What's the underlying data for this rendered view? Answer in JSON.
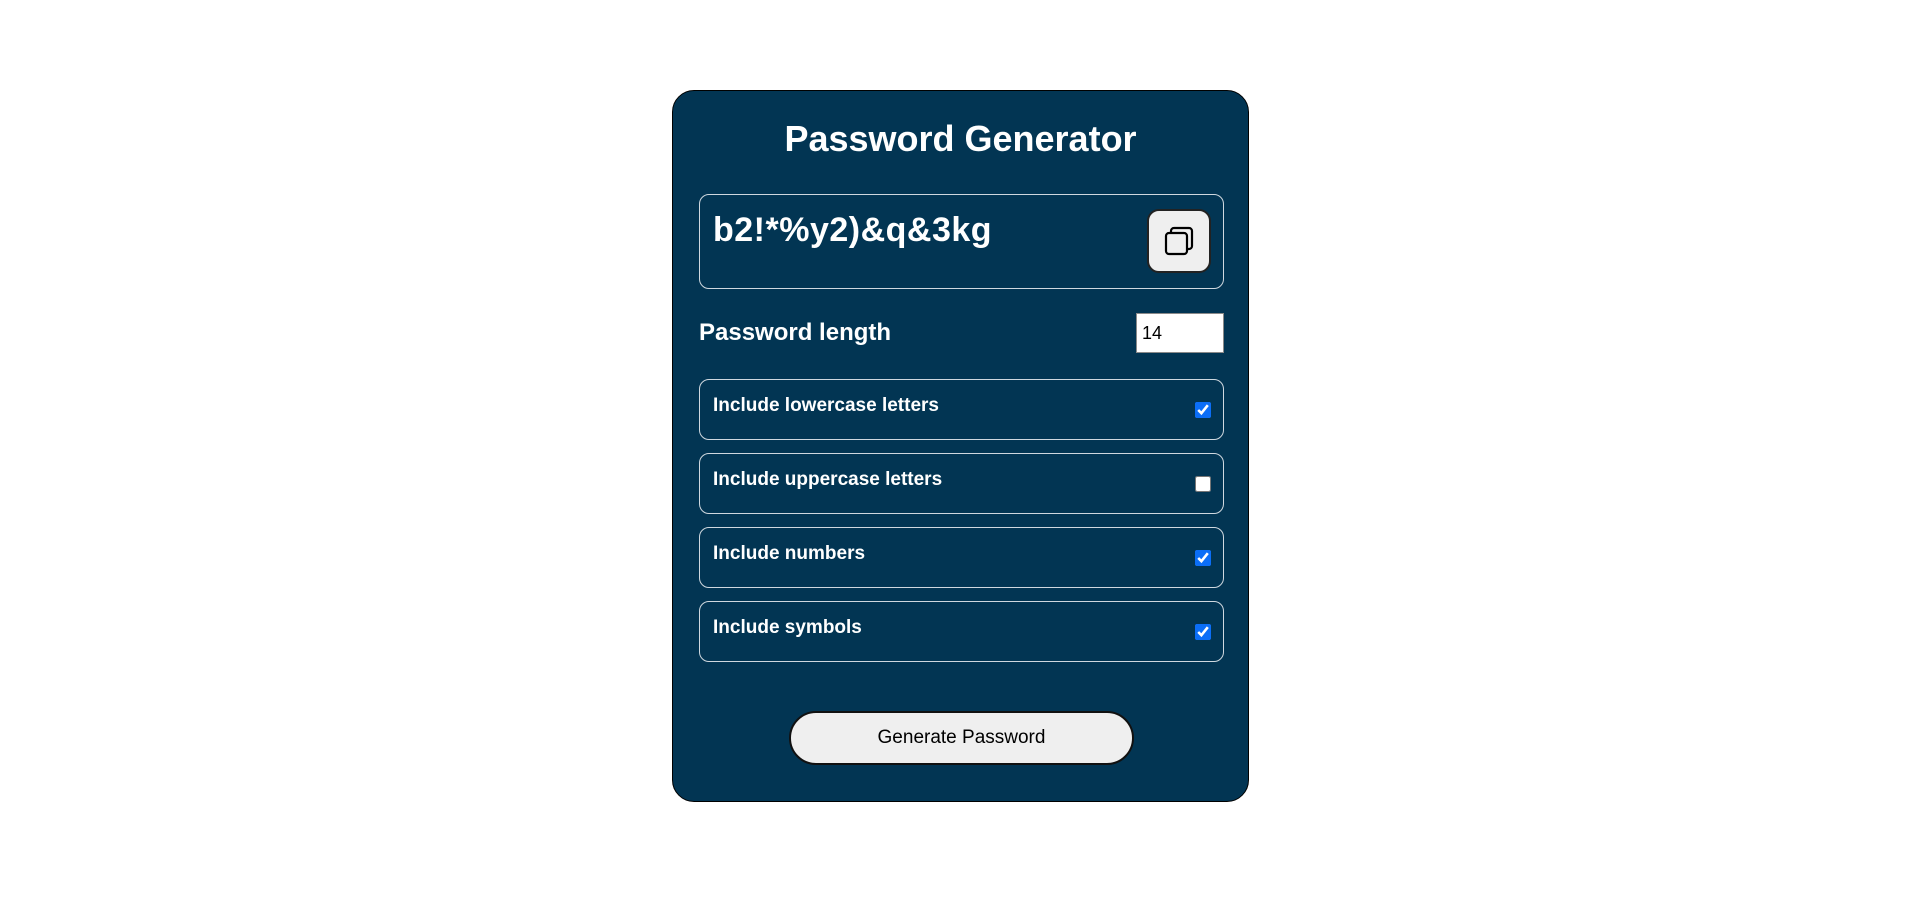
{
  "app": {
    "title": "Password Generator"
  },
  "result": {
    "password": "b2!*%y2)&q&3kg",
    "copy_icon": "copy-icon"
  },
  "length": {
    "label": "Password length",
    "value": "14"
  },
  "options": [
    {
      "label": "Include lowercase letters",
      "checked": true
    },
    {
      "label": "Include uppercase letters",
      "checked": false
    },
    {
      "label": "Include numbers",
      "checked": true
    },
    {
      "label": "Include symbols",
      "checked": true
    }
  ],
  "actions": {
    "generate_label": "Generate Password"
  },
  "colors": {
    "card_background": "#023553",
    "page_background": "#ffffff",
    "checkbox_accent": "#0b6ef7",
    "button_background": "#efefef"
  }
}
